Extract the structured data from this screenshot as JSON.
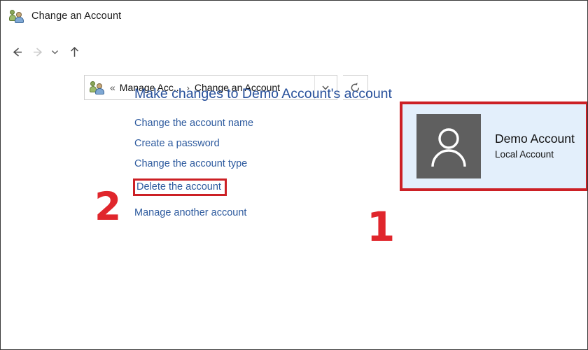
{
  "window": {
    "title": "Change an Account",
    "icon": "user-accounts-icon"
  },
  "navigation": {
    "back_label": "Back",
    "forward_label": "Forward",
    "recent_label": "Recent pages",
    "up_label": "Up one level",
    "refresh_label": "Refresh",
    "address_icon": "user-accounts-icon",
    "breadcrumb_overflow": "«",
    "breadcrumb_separator": "›",
    "breadcrumbs": [
      "Manage Acc...",
      "Change an Account"
    ],
    "dropdown_label": "Previous locations"
  },
  "main": {
    "heading": "Make changes to Demo Account's account",
    "tasks": [
      {
        "label": "Change the account name",
        "highlighted": false
      },
      {
        "label": "Create a password",
        "highlighted": false
      },
      {
        "label": "Change the account type",
        "highlighted": false
      },
      {
        "label": "Delete the account",
        "highlighted": true
      },
      {
        "label": "Manage another account",
        "highlighted": false
      }
    ]
  },
  "account_panel": {
    "avatar_icon": "person-silhouette-icon",
    "name": "Demo Account",
    "type": "Local Account"
  },
  "annotations": [
    {
      "id": "step-1",
      "label": "1",
      "target": "account-panel"
    },
    {
      "id": "step-2",
      "label": "2",
      "target": "delete-the-account-link"
    }
  ],
  "colors": {
    "heading_blue": "#27509b",
    "link_blue": "#2d5a9e",
    "annotation_red": "#cc2025",
    "panel_blue": "#e3effb",
    "avatar_gray": "#5f5f5f"
  }
}
